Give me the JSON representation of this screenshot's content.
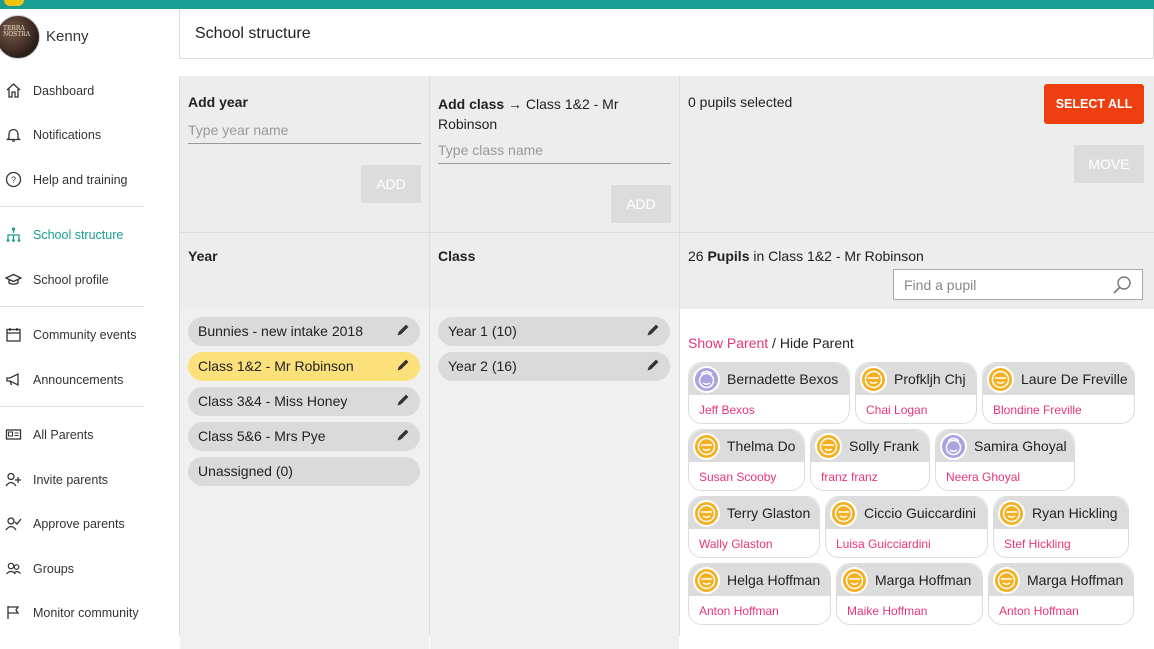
{
  "user": {
    "name": "Kenny",
    "avatar_text": "TERRA NOSTRA"
  },
  "nav": [
    {
      "label": "Dashboard",
      "icon": "home-icon"
    },
    {
      "label": "Notifications",
      "icon": "bell-icon"
    },
    {
      "label": "Help and training",
      "icon": "help-icon"
    },
    {
      "label": "School structure",
      "icon": "hierarchy-icon"
    },
    {
      "label": "School profile",
      "icon": "mortarboard-icon"
    },
    {
      "label": "Community events",
      "icon": "calendar-icon"
    },
    {
      "label": "Announcements",
      "icon": "megaphone-icon"
    },
    {
      "label": "All Parents",
      "icon": "id-card-icon"
    },
    {
      "label": "Invite parents",
      "icon": "add-user-icon"
    },
    {
      "label": "Approve parents",
      "icon": "approve-user-icon"
    },
    {
      "label": "Groups",
      "icon": "group-icon"
    },
    {
      "label": "Monitor community",
      "icon": "monitor-icon"
    }
  ],
  "page": {
    "title": "School structure"
  },
  "add_year": {
    "label": "Add year",
    "placeholder": "Type year name",
    "button": "ADD"
  },
  "add_class": {
    "label": "Add class",
    "arrow": "→",
    "target": "Class 1&2 - Mr Robinson",
    "placeholder": "Type class name",
    "button": "ADD"
  },
  "selection": {
    "status": "0 pupils selected",
    "select_all": "SELECT ALL",
    "move": "MOVE"
  },
  "year_header": "Year",
  "class_header": "Class",
  "pupils_header": {
    "count": "26",
    "word": "Pupils",
    "suffix": "in Class 1&2 - Mr Robinson"
  },
  "search": {
    "placeholder": "Find a pupil"
  },
  "years": [
    {
      "label": "Bunnies - new intake 2018",
      "editable": true,
      "selected": false
    },
    {
      "label": "Class 1&2 - Mr Robinson",
      "editable": true,
      "selected": true
    },
    {
      "label": "Class 3&4 - Miss Honey",
      "editable": true,
      "selected": false
    },
    {
      "label": "Class 5&6 - Mrs Pye",
      "editable": true,
      "selected": false
    },
    {
      "label": "Unassigned (0)",
      "editable": false,
      "selected": false
    }
  ],
  "classes": [
    {
      "label": "Year 1 (10)"
    },
    {
      "label": "Year 2 (16)"
    }
  ],
  "parent_toggle": {
    "show": "Show Parent",
    "sep": " / ",
    "hide": "Hide Parent"
  },
  "pupils": [
    {
      "name": "Bernadette Bexos",
      "parent": "Jeff Bexos",
      "avatar": "purple"
    },
    {
      "name": "Profkljh Chj",
      "parent": "Chai Logan",
      "avatar": "orange"
    },
    {
      "name": "Laure De Freville",
      "parent": "Blondine Freville",
      "avatar": "orange"
    },
    {
      "name": "Thelma Do",
      "parent": "Susan Scooby",
      "avatar": "orange"
    },
    {
      "name": "Solly Frank",
      "parent": "franz franz",
      "avatar": "orange"
    },
    {
      "name": "Samira Ghoyal",
      "parent": "Neera Ghoyal",
      "avatar": "purple"
    },
    {
      "name": "Terry Glaston",
      "parent": "Wally Glaston",
      "avatar": "orange"
    },
    {
      "name": "Ciccio Guiccardini",
      "parent": "Luisa Guicciardini",
      "avatar": "orange"
    },
    {
      "name": "Ryan Hickling",
      "parent": "Stef Hickling",
      "avatar": "orange"
    },
    {
      "name": "Helga Hoffman",
      "parent": "Anton Hoffman",
      "avatar": "orange"
    },
    {
      "name": "Marga Hoffman",
      "parent": "Maike Hoffman",
      "avatar": "orange"
    },
    {
      "name": "Marga Hoffman",
      "parent": "Anton Hoffman",
      "avatar": "orange"
    }
  ],
  "colors": {
    "accent": "#1a9e94",
    "orange_button": "#ee3f11",
    "selected_year": "#fce17a",
    "parent_link": "#e8357a"
  }
}
